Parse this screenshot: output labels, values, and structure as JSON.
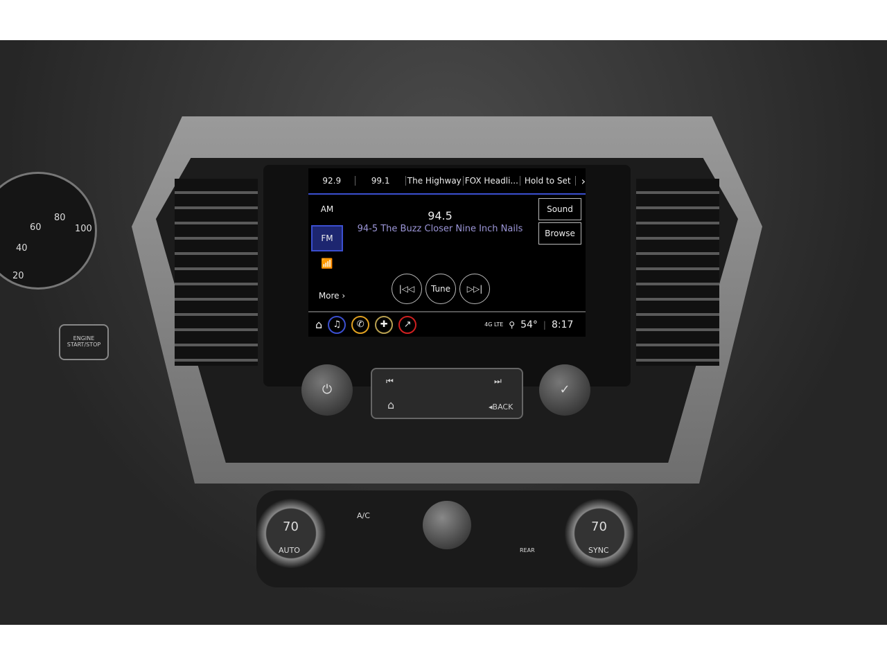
{
  "screen": {
    "presets": [
      "92.9",
      "99.1",
      "The Highway",
      "FOX Headli...",
      "Hold to Set"
    ],
    "next_icon": "chevron-right-icon",
    "bands": {
      "am": "AM",
      "fm": "FM",
      "more": "More ›"
    },
    "frequency": "94.5",
    "now_playing": "94-5 The Buzz Closer Nine Inch Nails",
    "sound": "Sound",
    "browse": "Browse",
    "prev": "|◁◁",
    "tune": "Tune",
    "next": "▷▷|",
    "status": {
      "network": "4G LTE",
      "temperature": "54°",
      "time": "8:17"
    },
    "accent": "#3b4fd0"
  },
  "controls": {
    "back": "◂BACK",
    "power": "⏻",
    "check": "✓",
    "seek_back": "⏮",
    "seek_fwd": "⏭",
    "home": "⌂"
  },
  "climate": {
    "left_temp": "70",
    "right_temp": "70",
    "auto": "AUTO",
    "sync": "SYNC",
    "ac": "A/C",
    "rear": "REAR"
  },
  "cluster": {
    "ticks": [
      "20",
      "40",
      "60",
      "80",
      "100"
    ]
  },
  "engine": "ENGINE START/STOP"
}
